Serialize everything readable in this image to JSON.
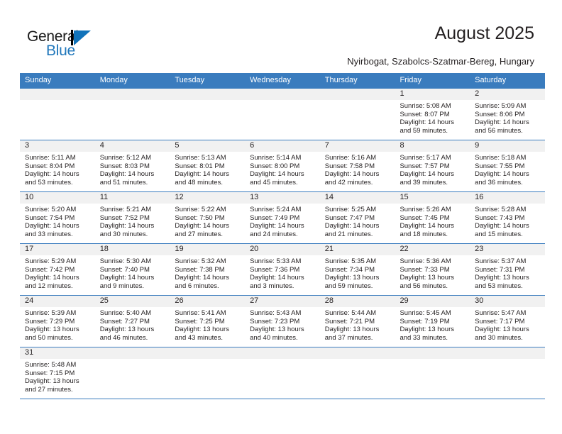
{
  "brand": {
    "word_general": "General",
    "word_blue": "Blue",
    "logo_icon": "triangle-logo-icon",
    "accent_color": "#1173ba"
  },
  "header": {
    "title": "August 2025",
    "subtitle": "Nyirbogat, Szabolcs-Szatmar-Bereg, Hungary"
  },
  "theme": {
    "header_row_bg": "#3a7cbe",
    "daynum_band_bg": "#f1f1f1",
    "grid_line": "#3a7cbe",
    "text": "#231f20"
  },
  "weekday_headers": [
    "Sunday",
    "Monday",
    "Tuesday",
    "Wednesday",
    "Thursday",
    "Friday",
    "Saturday"
  ],
  "weeks": [
    [
      {
        "day": "",
        "lines": []
      },
      {
        "day": "",
        "lines": []
      },
      {
        "day": "",
        "lines": []
      },
      {
        "day": "",
        "lines": []
      },
      {
        "day": "",
        "lines": []
      },
      {
        "day": "1",
        "lines": [
          "Sunrise: 5:08 AM",
          "Sunset: 8:07 PM",
          "Daylight: 14 hours",
          "and 59 minutes."
        ]
      },
      {
        "day": "2",
        "lines": [
          "Sunrise: 5:09 AM",
          "Sunset: 8:06 PM",
          "Daylight: 14 hours",
          "and 56 minutes."
        ]
      }
    ],
    [
      {
        "day": "3",
        "lines": [
          "Sunrise: 5:11 AM",
          "Sunset: 8:04 PM",
          "Daylight: 14 hours",
          "and 53 minutes."
        ]
      },
      {
        "day": "4",
        "lines": [
          "Sunrise: 5:12 AM",
          "Sunset: 8:03 PM",
          "Daylight: 14 hours",
          "and 51 minutes."
        ]
      },
      {
        "day": "5",
        "lines": [
          "Sunrise: 5:13 AM",
          "Sunset: 8:01 PM",
          "Daylight: 14 hours",
          "and 48 minutes."
        ]
      },
      {
        "day": "6",
        "lines": [
          "Sunrise: 5:14 AM",
          "Sunset: 8:00 PM",
          "Daylight: 14 hours",
          "and 45 minutes."
        ]
      },
      {
        "day": "7",
        "lines": [
          "Sunrise: 5:16 AM",
          "Sunset: 7:58 PM",
          "Daylight: 14 hours",
          "and 42 minutes."
        ]
      },
      {
        "day": "8",
        "lines": [
          "Sunrise: 5:17 AM",
          "Sunset: 7:57 PM",
          "Daylight: 14 hours",
          "and 39 minutes."
        ]
      },
      {
        "day": "9",
        "lines": [
          "Sunrise: 5:18 AM",
          "Sunset: 7:55 PM",
          "Daylight: 14 hours",
          "and 36 minutes."
        ]
      }
    ],
    [
      {
        "day": "10",
        "lines": [
          "Sunrise: 5:20 AM",
          "Sunset: 7:54 PM",
          "Daylight: 14 hours",
          "and 33 minutes."
        ]
      },
      {
        "day": "11",
        "lines": [
          "Sunrise: 5:21 AM",
          "Sunset: 7:52 PM",
          "Daylight: 14 hours",
          "and 30 minutes."
        ]
      },
      {
        "day": "12",
        "lines": [
          "Sunrise: 5:22 AM",
          "Sunset: 7:50 PM",
          "Daylight: 14 hours",
          "and 27 minutes."
        ]
      },
      {
        "day": "13",
        "lines": [
          "Sunrise: 5:24 AM",
          "Sunset: 7:49 PM",
          "Daylight: 14 hours",
          "and 24 minutes."
        ]
      },
      {
        "day": "14",
        "lines": [
          "Sunrise: 5:25 AM",
          "Sunset: 7:47 PM",
          "Daylight: 14 hours",
          "and 21 minutes."
        ]
      },
      {
        "day": "15",
        "lines": [
          "Sunrise: 5:26 AM",
          "Sunset: 7:45 PM",
          "Daylight: 14 hours",
          "and 18 minutes."
        ]
      },
      {
        "day": "16",
        "lines": [
          "Sunrise: 5:28 AM",
          "Sunset: 7:43 PM",
          "Daylight: 14 hours",
          "and 15 minutes."
        ]
      }
    ],
    [
      {
        "day": "17",
        "lines": [
          "Sunrise: 5:29 AM",
          "Sunset: 7:42 PM",
          "Daylight: 14 hours",
          "and 12 minutes."
        ]
      },
      {
        "day": "18",
        "lines": [
          "Sunrise: 5:30 AM",
          "Sunset: 7:40 PM",
          "Daylight: 14 hours",
          "and 9 minutes."
        ]
      },
      {
        "day": "19",
        "lines": [
          "Sunrise: 5:32 AM",
          "Sunset: 7:38 PM",
          "Daylight: 14 hours",
          "and 6 minutes."
        ]
      },
      {
        "day": "20",
        "lines": [
          "Sunrise: 5:33 AM",
          "Sunset: 7:36 PM",
          "Daylight: 14 hours",
          "and 3 minutes."
        ]
      },
      {
        "day": "21",
        "lines": [
          "Sunrise: 5:35 AM",
          "Sunset: 7:34 PM",
          "Daylight: 13 hours",
          "and 59 minutes."
        ]
      },
      {
        "day": "22",
        "lines": [
          "Sunrise: 5:36 AM",
          "Sunset: 7:33 PM",
          "Daylight: 13 hours",
          "and 56 minutes."
        ]
      },
      {
        "day": "23",
        "lines": [
          "Sunrise: 5:37 AM",
          "Sunset: 7:31 PM",
          "Daylight: 13 hours",
          "and 53 minutes."
        ]
      }
    ],
    [
      {
        "day": "24",
        "lines": [
          "Sunrise: 5:39 AM",
          "Sunset: 7:29 PM",
          "Daylight: 13 hours",
          "and 50 minutes."
        ]
      },
      {
        "day": "25",
        "lines": [
          "Sunrise: 5:40 AM",
          "Sunset: 7:27 PM",
          "Daylight: 13 hours",
          "and 46 minutes."
        ]
      },
      {
        "day": "26",
        "lines": [
          "Sunrise: 5:41 AM",
          "Sunset: 7:25 PM",
          "Daylight: 13 hours",
          "and 43 minutes."
        ]
      },
      {
        "day": "27",
        "lines": [
          "Sunrise: 5:43 AM",
          "Sunset: 7:23 PM",
          "Daylight: 13 hours",
          "and 40 minutes."
        ]
      },
      {
        "day": "28",
        "lines": [
          "Sunrise: 5:44 AM",
          "Sunset: 7:21 PM",
          "Daylight: 13 hours",
          "and 37 minutes."
        ]
      },
      {
        "day": "29",
        "lines": [
          "Sunrise: 5:45 AM",
          "Sunset: 7:19 PM",
          "Daylight: 13 hours",
          "and 33 minutes."
        ]
      },
      {
        "day": "30",
        "lines": [
          "Sunrise: 5:47 AM",
          "Sunset: 7:17 PM",
          "Daylight: 13 hours",
          "and 30 minutes."
        ]
      }
    ],
    [
      {
        "day": "31",
        "lines": [
          "Sunrise: 5:48 AM",
          "Sunset: 7:15 PM",
          "Daylight: 13 hours",
          "and 27 minutes."
        ]
      },
      {
        "day": "",
        "lines": []
      },
      {
        "day": "",
        "lines": []
      },
      {
        "day": "",
        "lines": []
      },
      {
        "day": "",
        "lines": []
      },
      {
        "day": "",
        "lines": []
      },
      {
        "day": "",
        "lines": []
      }
    ]
  ]
}
